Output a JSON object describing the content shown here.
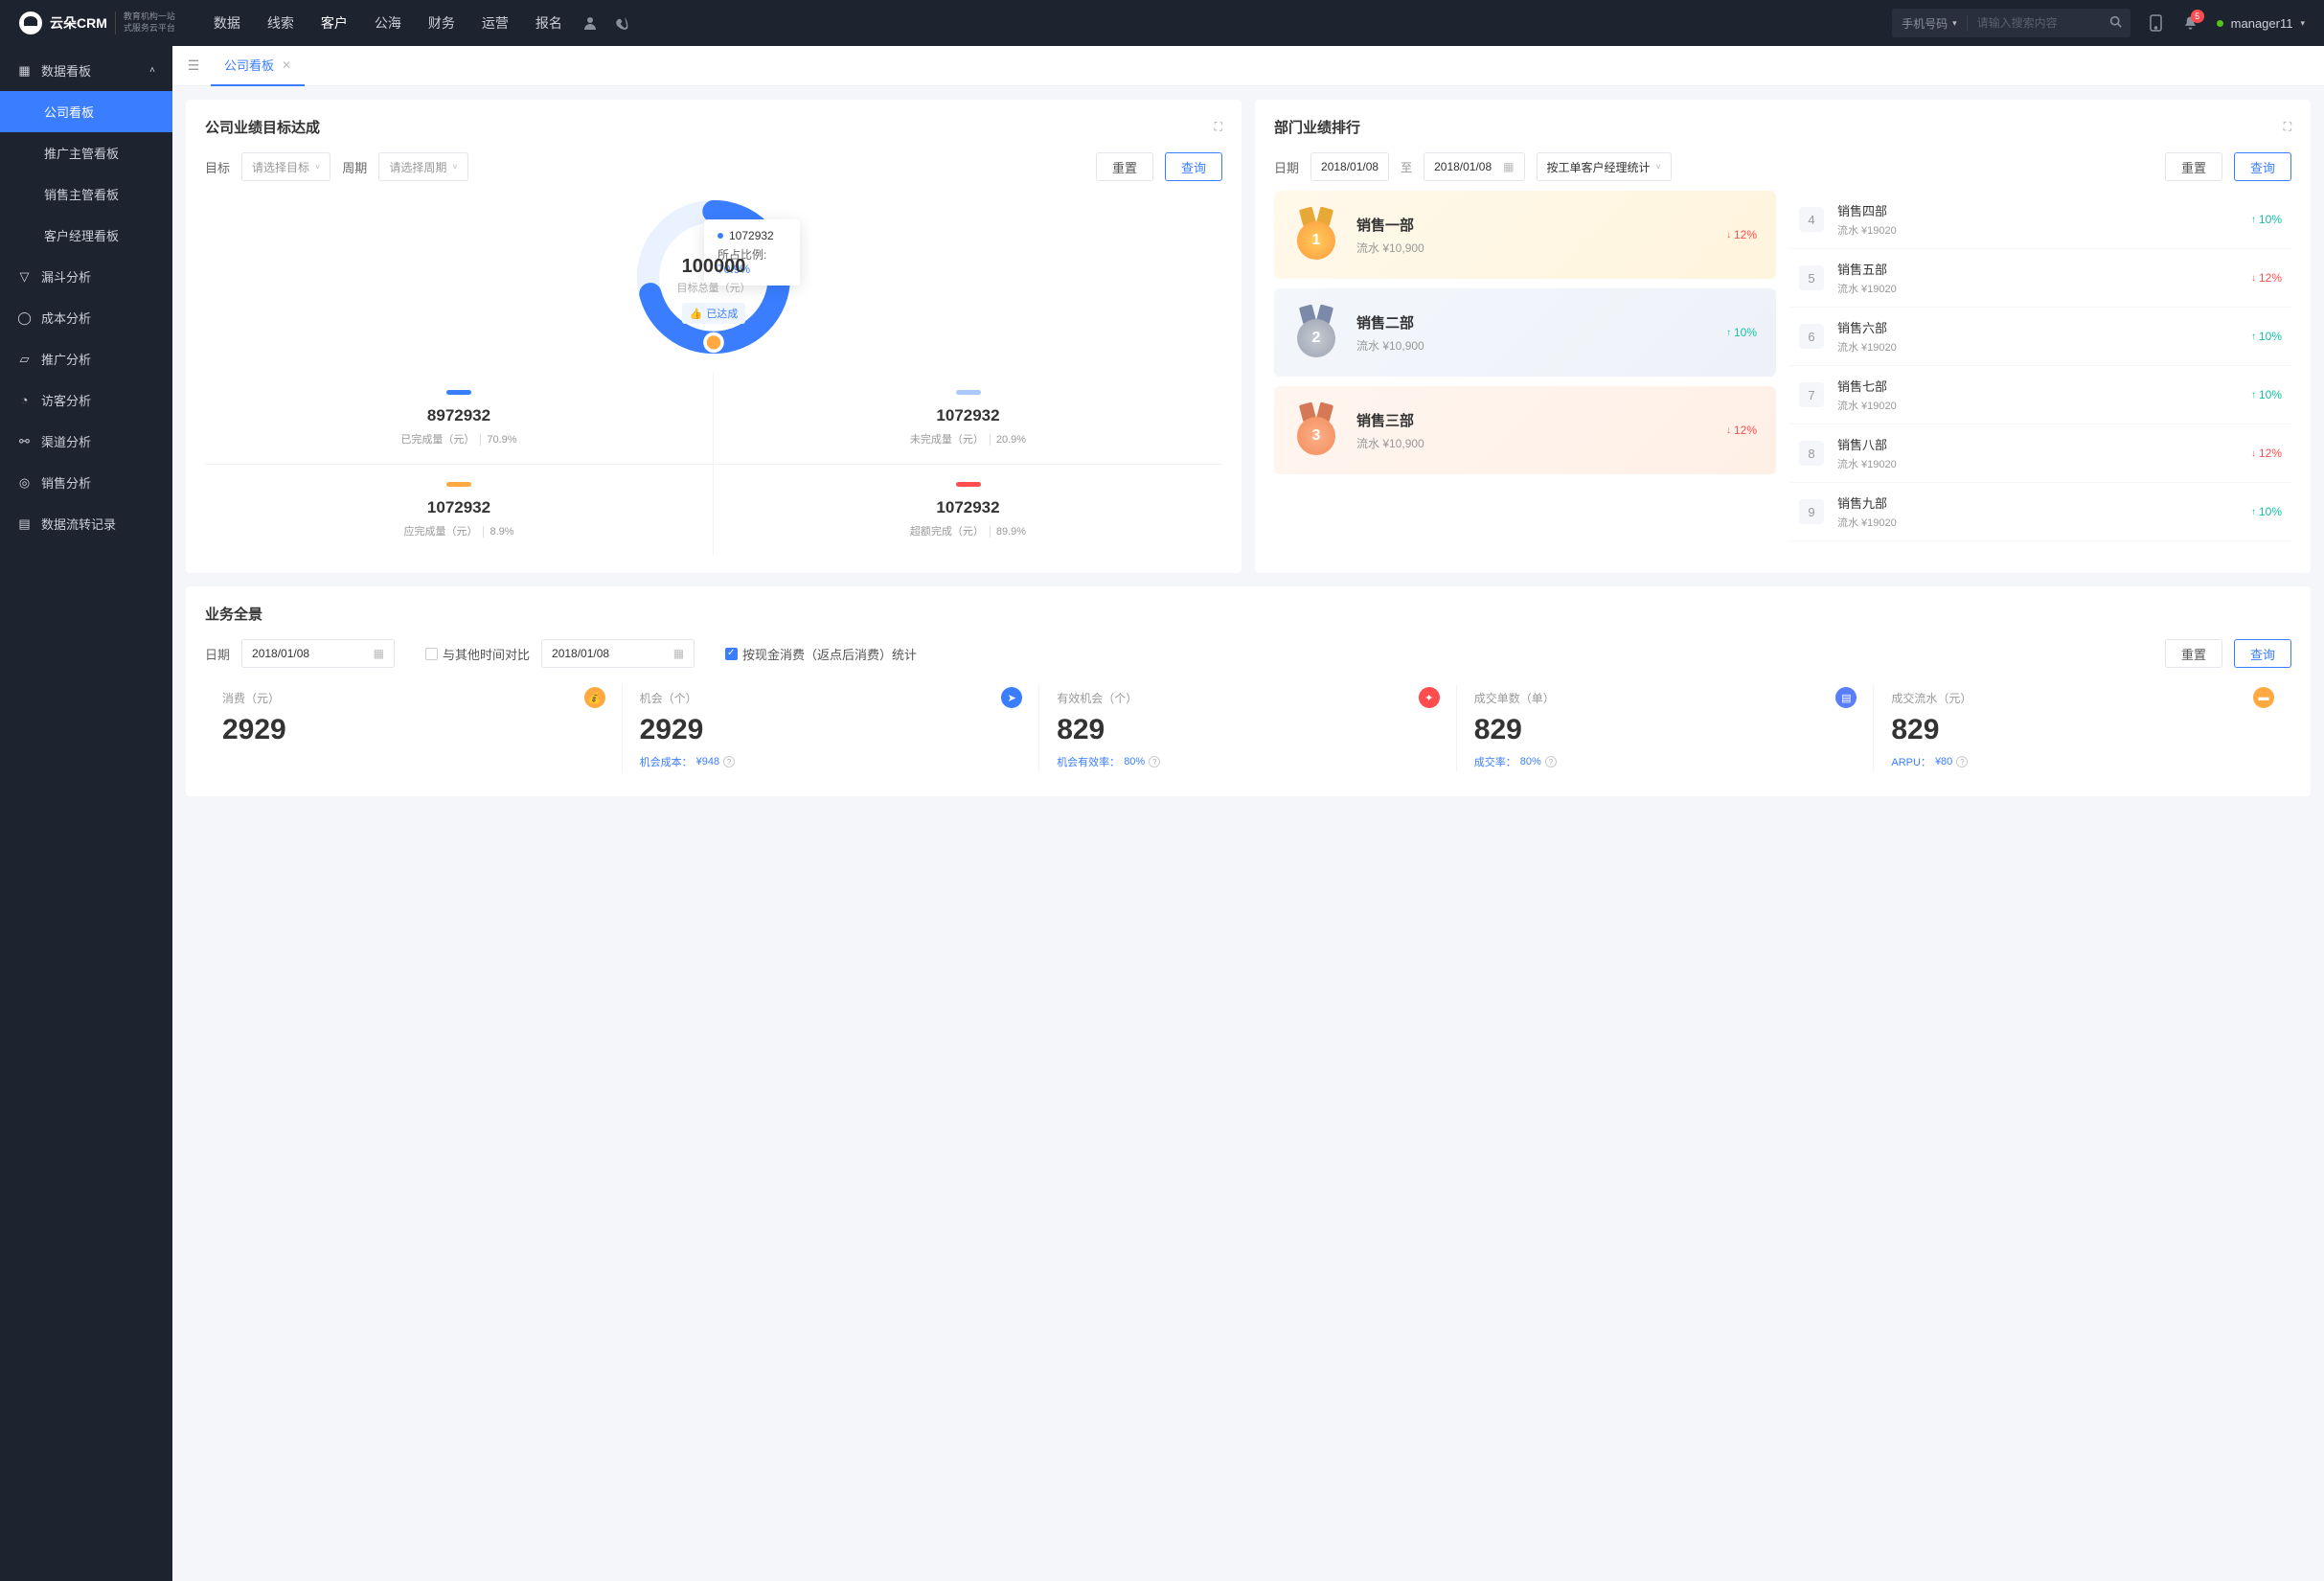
{
  "topbar": {
    "logo_main": "云朵CRM",
    "logo_sub1": "教育机构一站",
    "logo_sub2": "式服务云平台",
    "nav": [
      "数据",
      "线索",
      "客户",
      "公海",
      "财务",
      "运营",
      "报名"
    ],
    "nav_active_idx": 2,
    "search_type": "手机号码",
    "search_placeholder": "请输入搜索内容",
    "notif_count": "5",
    "username": "manager11"
  },
  "sidebar": {
    "header": "数据看板",
    "sub": [
      "公司看板",
      "推广主管看板",
      "销售主管看板",
      "客户经理看板"
    ],
    "active_sub_idx": 0,
    "items": [
      "漏斗分析",
      "成本分析",
      "推广分析",
      "访客分析",
      "渠道分析",
      "销售分析",
      "数据流转记录"
    ]
  },
  "tabbar": {
    "active": "公司看板"
  },
  "goal": {
    "title": "公司业绩目标达成",
    "target_lbl": "目标",
    "target_ph": "请选择目标",
    "period_lbl": "周期",
    "period_ph": "请选择周期",
    "reset": "重置",
    "query": "查询",
    "donut": {
      "total": "100000",
      "total_lbl": "目标总量（元）",
      "badge": "已达成"
    },
    "tooltip": {
      "val": "1072932",
      "ratio_lbl": "所占比例:",
      "pct": "70.9%"
    },
    "stats": [
      {
        "bar": "c-blue",
        "val": "8972932",
        "lbl": "已完成量（元）",
        "pct": "70.9%"
      },
      {
        "bar": "c-lblue",
        "val": "1072932",
        "lbl": "未完成量（元）",
        "pct": "20.9%"
      },
      {
        "bar": "c-orange",
        "val": "1072932",
        "lbl": "应完成量（元）",
        "pct": "8.9%"
      },
      {
        "bar": "c-red",
        "val": "1072932",
        "lbl": "超额完成（元）",
        "pct": "89.9%"
      }
    ]
  },
  "rank": {
    "title": "部门业绩排行",
    "date_lbl": "日期",
    "date1": "2018/01/08",
    "to_txt": "至",
    "date2": "2018/01/08",
    "group_by": "按工单客户经理统计",
    "reset": "重置",
    "query": "查询",
    "top3": [
      {
        "n": "1",
        "name": "销售一部",
        "amt": "流水 ¥10,900",
        "pct": "12%",
        "dir": "down"
      },
      {
        "n": "2",
        "name": "销售二部",
        "amt": "流水 ¥10,900",
        "pct": "10%",
        "dir": "up"
      },
      {
        "n": "3",
        "name": "销售三部",
        "amt": "流水 ¥10,900",
        "pct": "12%",
        "dir": "down"
      }
    ],
    "rest": [
      {
        "n": "4",
        "name": "销售四部",
        "amt": "流水 ¥19020",
        "pct": "10%",
        "dir": "up"
      },
      {
        "n": "5",
        "name": "销售五部",
        "amt": "流水 ¥19020",
        "pct": "12%",
        "dir": "down"
      },
      {
        "n": "6",
        "name": "销售六部",
        "amt": "流水 ¥19020",
        "pct": "10%",
        "dir": "up"
      },
      {
        "n": "7",
        "name": "销售七部",
        "amt": "流水 ¥19020",
        "pct": "10%",
        "dir": "up"
      },
      {
        "n": "8",
        "name": "销售八部",
        "amt": "流水 ¥19020",
        "pct": "12%",
        "dir": "down"
      },
      {
        "n": "9",
        "name": "销售九部",
        "amt": "流水 ¥19020",
        "pct": "10%",
        "dir": "up"
      }
    ]
  },
  "overview": {
    "title": "业务全景",
    "date_lbl": "日期",
    "date1": "2018/01/08",
    "compare_lbl": "与其他时间对比",
    "date2": "2018/01/08",
    "cash_lbl": "按现金消费（返点后消费）统计",
    "reset": "重置",
    "query": "查询",
    "metrics": [
      {
        "lbl": "消费（元）",
        "val": "2929",
        "icon": "mi-orange",
        "glyph": "💰",
        "sub": "",
        "subv": ""
      },
      {
        "lbl": "机会（个）",
        "val": "2929",
        "icon": "mi-blue",
        "glyph": "➤",
        "sub": "机会成本：",
        "subv": "¥948"
      },
      {
        "lbl": "有效机会（个）",
        "val": "829",
        "icon": "mi-red",
        "glyph": "✦",
        "sub": "机会有效率：",
        "subv": "80%"
      },
      {
        "lbl": "成交单数（单）",
        "val": "829",
        "icon": "mi-purple",
        "glyph": "▤",
        "sub": "成交率：",
        "subv": "80%"
      },
      {
        "lbl": "成交流水（元）",
        "val": "829",
        "icon": "mi-yellow",
        "glyph": "▬",
        "sub": "ARPU：",
        "subv": "¥80"
      }
    ]
  }
}
